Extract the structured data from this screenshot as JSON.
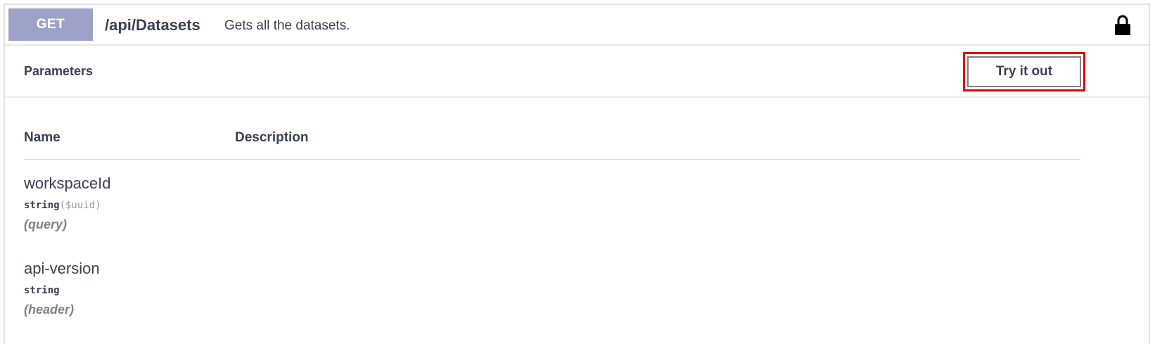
{
  "operation": {
    "method": "GET",
    "path": "/api/Datasets",
    "description": "Gets all the datasets.",
    "lock_icon": "lock-icon",
    "method_color": "#9ea2c9"
  },
  "parameters_section": {
    "title": "Parameters",
    "try_button_label": "Try it out",
    "highlight_color": "#e30000"
  },
  "table": {
    "columns": [
      "Name",
      "Description"
    ],
    "rows": [
      {
        "name": "workspaceId",
        "type": "string",
        "format": "($uuid)",
        "in": "(query)"
      },
      {
        "name": "api-version",
        "type": "string",
        "format": "",
        "in": "(header)"
      }
    ]
  }
}
